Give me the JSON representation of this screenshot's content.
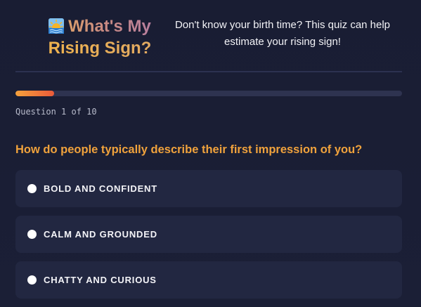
{
  "header": {
    "title_line1": "What's My",
    "title_line2": "Rising Sign?",
    "icon": "sunrise-icon",
    "subtitle": "Don't know your birth time? This quiz can help estimate your rising sign!"
  },
  "progress": {
    "current": 1,
    "total": 10,
    "fraction": 0.1,
    "label": "Question 1 of 10"
  },
  "question": {
    "text": "How do people typically describe their first impression of you?"
  },
  "options": [
    {
      "label": "BOLD AND CONFIDENT",
      "selected": false
    },
    {
      "label": "CALM AND GROUNDED",
      "selected": false
    },
    {
      "label": "CHATTY AND CURIOUS",
      "selected": false
    }
  ],
  "colors": {
    "background": "#1a1e35",
    "accent": "#f0a23c",
    "option_bg": "#222741",
    "progress_start": "#f5a23c",
    "progress_end": "#ea5a3a"
  }
}
